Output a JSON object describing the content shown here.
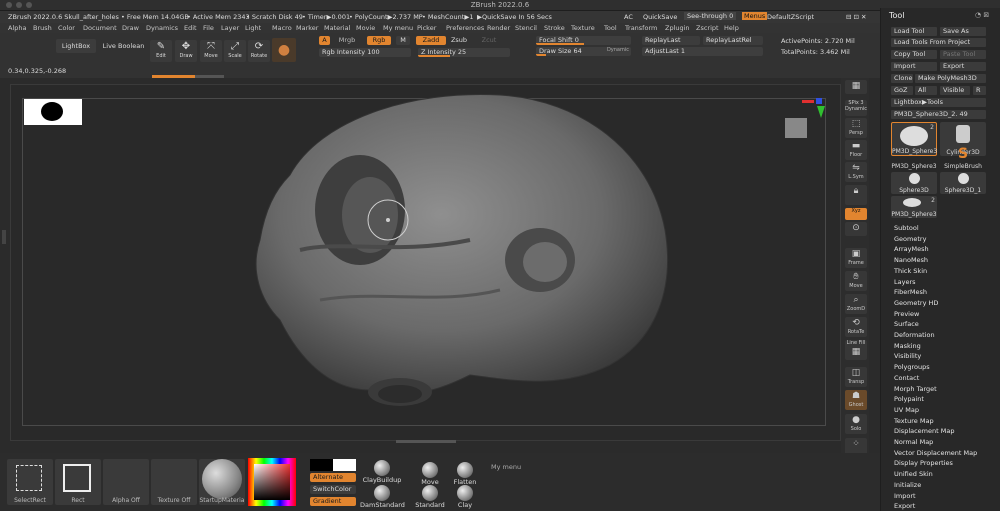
{
  "window": {
    "title": "ZBrush 2022.0.6"
  },
  "status": {
    "app_doc": "ZBrush 2022.0.6 Skull_after_holes",
    "free_mem": "• Free Mem 14.04GB",
    "active_mem": "• Active Mem 2343",
    "scratch": "• Scratch Disk 49",
    "timer": "• Timer▶0.001",
    "polycount": "• PolyCount▶2.737 MP",
    "meshcount": "• MeshCount▶1",
    "quicksave_in": "▶QuickSave In 56 Secs",
    "ac": "AC",
    "quicksave": "QuickSave",
    "see_through": "See-through 0",
    "menus": "Menus",
    "default_zscript": "DefaultZScript"
  },
  "menus": [
    "Alpha",
    "Brush",
    "Color",
    "Document",
    "Draw",
    "Dynamics",
    "Edit",
    "File",
    "Layer",
    "Light",
    "Macro",
    "Marker",
    "Material",
    "Movie",
    "My menu",
    "Picker",
    "Preferences",
    "Render",
    "Stencil",
    "Stroke",
    "Texture",
    "Tool",
    "Transform",
    "Zplugin",
    "Zscript",
    "Help"
  ],
  "toolbar": {
    "lightbox": "LightBox",
    "live_boolean": "Live Boolean",
    "edit": "Edit",
    "draw": "Draw",
    "move": "Move",
    "scale": "Scale",
    "rotate": "Rotate",
    "a": "A",
    "mrgb": "Mrgb",
    "rgb": "Rgb",
    "m": "M",
    "zadd": "Zadd",
    "zsub": "Zsub",
    "zcut": "Zcut",
    "rgb_intensity": "Rgb Intensity 100",
    "z_intensity": "Z Intensity 25",
    "focal_shift": "Focal Shift 0",
    "draw_size": "Draw Size 64",
    "dynamic": "Dynamic",
    "replay_last": "ReplayLast",
    "replay_last_rel": "ReplayLastRel",
    "adjust_last": "AdjustLast 1",
    "active_points": "ActivePoints: 2.720 Mil",
    "total_points": "TotalPoints: 3.462 Mil",
    "coords": "0.34,0.325,-0.268",
    "progress_fraction": 0.6
  },
  "right_shelf": [
    "SPix 3",
    "Dynamic",
    "Persp",
    "Floor",
    "L.Sym",
    "Xyz",
    "Frame",
    "Move",
    "ZoomD",
    "RotaTe",
    "Line Fill",
    "Transp",
    "Ghost",
    "Solo"
  ],
  "tool_panel": {
    "title": "Tool",
    "load_tool": "Load Tool",
    "save_as": "Save As",
    "load_from_project": "Load Tools From Project",
    "copy_tool": "Copy Tool",
    "paste_tool": "Paste Tool",
    "import": "Import",
    "export": "Export",
    "clone": "Clone",
    "make_polymesh": "Make PolyMesh3D",
    "goz": "GoZ",
    "all": "All",
    "visible": "Visible",
    "r": "R",
    "lightbox_tools": "Lightbox▶Tools",
    "current_tool": "PM3D_Sphere3D_2. 49",
    "tools": [
      {
        "name": "PM3D_Sphere3",
        "count": "2"
      },
      {
        "name": "Cylinder3D",
        "count": ""
      },
      {
        "name": "PM3D_Sphere3",
        "count": ""
      },
      {
        "name": "SimpleBrush",
        "count": ""
      },
      {
        "name": "Sphere3D",
        "count": ""
      },
      {
        "name": "Sphere3D_1",
        "count": ""
      },
      {
        "name": "PM3D_Sphere3",
        "count": "2"
      }
    ],
    "sections": [
      "Subtool",
      "Geometry",
      "ArrayMesh",
      "NanoMesh",
      "Thick Skin",
      "Layers",
      "FiberMesh",
      "Geometry HD",
      "Preview",
      "Surface",
      "Deformation",
      "Masking",
      "Visibility",
      "Polygroups",
      "Contact",
      "Morph Target",
      "Polypaint",
      "UV Map",
      "Texture Map",
      "Displacement Map",
      "Normal Map",
      "Vector Displacement Map",
      "Display Properties",
      "Unified Skin",
      "Initialize",
      "Import",
      "Export"
    ]
  },
  "bottom_bar": {
    "select_rect": "SelectRect",
    "rect": "Rect",
    "alpha_off": "Alpha Off",
    "texture_off": "Texture Off",
    "material": "StartupMateria",
    "alternate": "Alternate",
    "switch_color": "SwitchColor",
    "gradient": "Gradient",
    "brushes": [
      "ClayBuildup",
      "Move",
      "Flatten",
      "DamStandard",
      "Standard",
      "Clay"
    ],
    "my_menu": "My menu"
  },
  "colors": {
    "accent": "#e2852f",
    "background": "#2b2b2b",
    "panel": "#282828"
  }
}
